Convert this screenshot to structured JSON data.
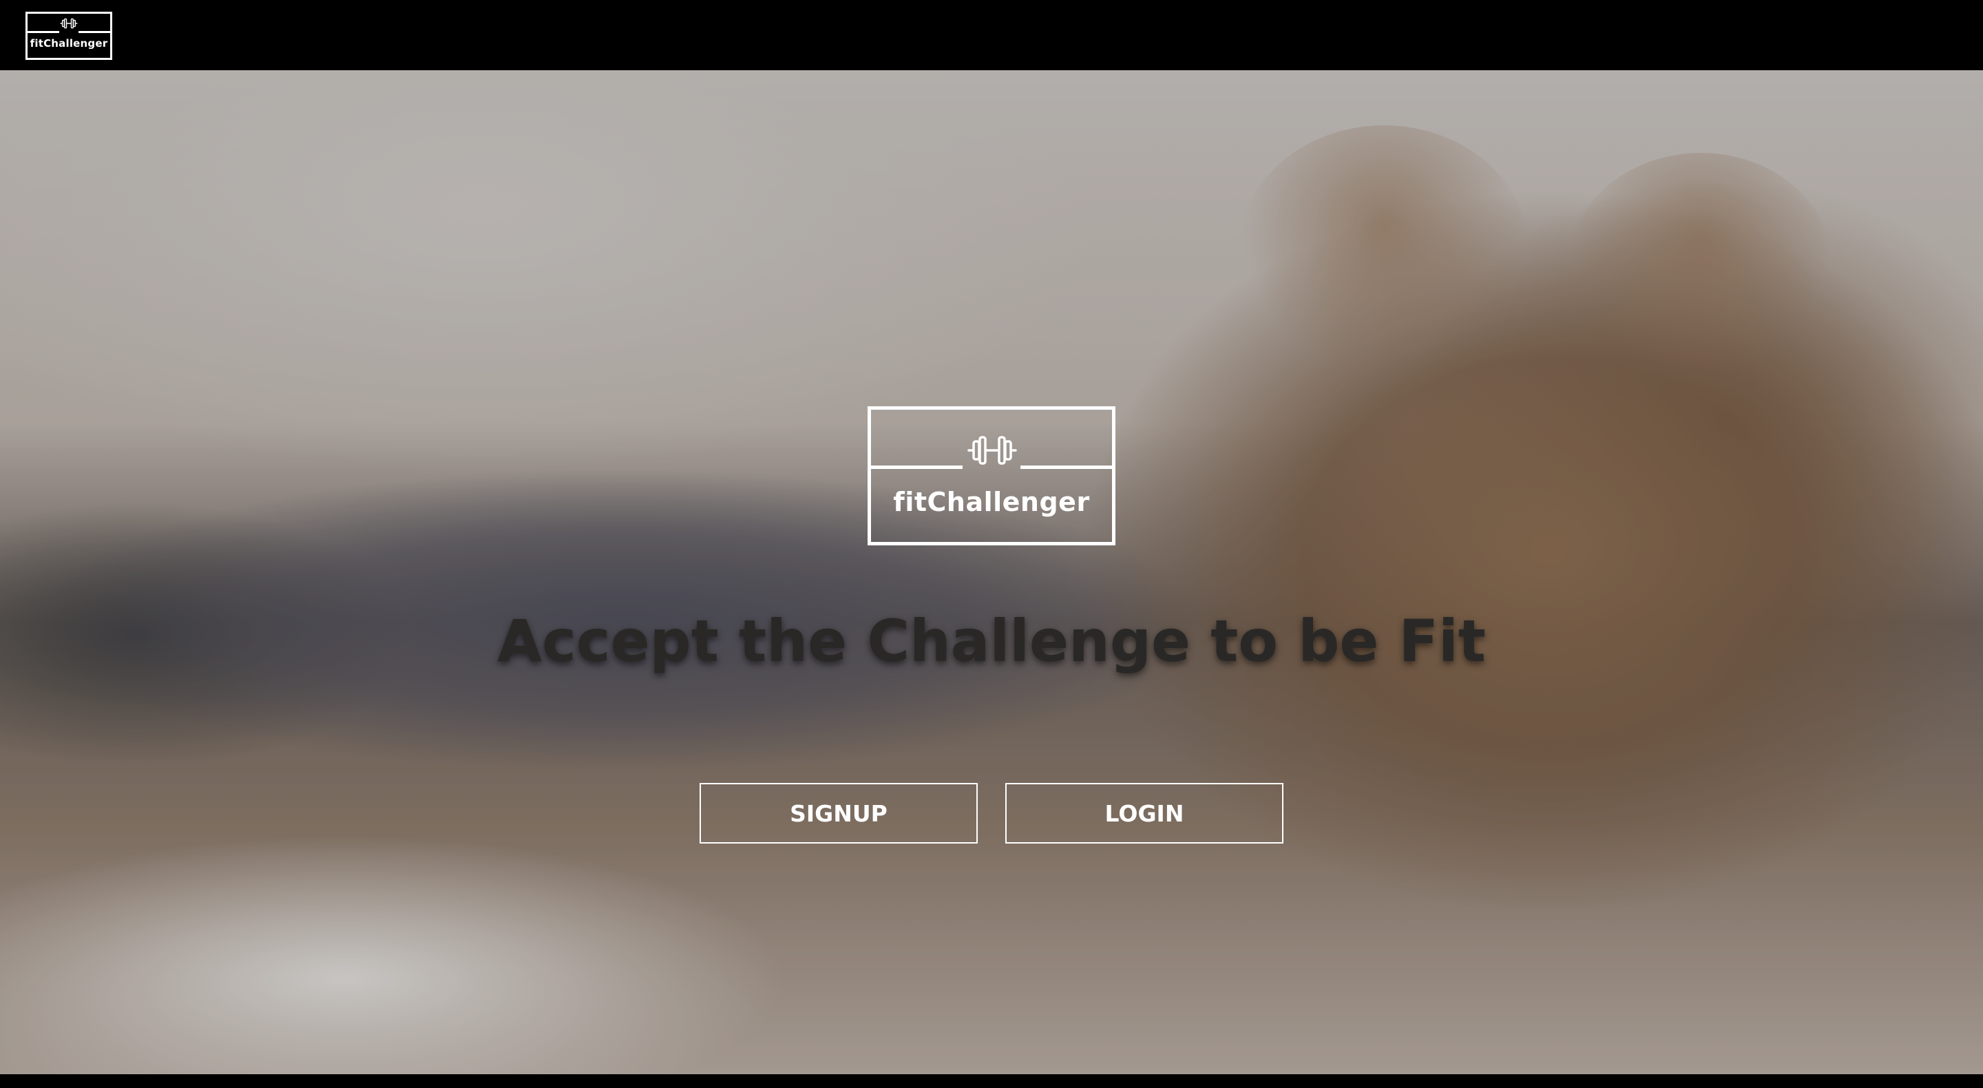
{
  "header": {
    "logo_text": "fitChallenger",
    "logo_icon": "dumbbell-icon"
  },
  "hero": {
    "logo_text": "fitChallenger",
    "logo_icon": "dumbbell-icon",
    "headline": "Accept the Challenge to be Fit",
    "signup_label": "SIGNUP",
    "login_label": "LOGIN"
  },
  "colors": {
    "topbar": "#000000",
    "headline": "#2a2826",
    "button_border": "#ffffff",
    "button_text": "#ffffff"
  }
}
